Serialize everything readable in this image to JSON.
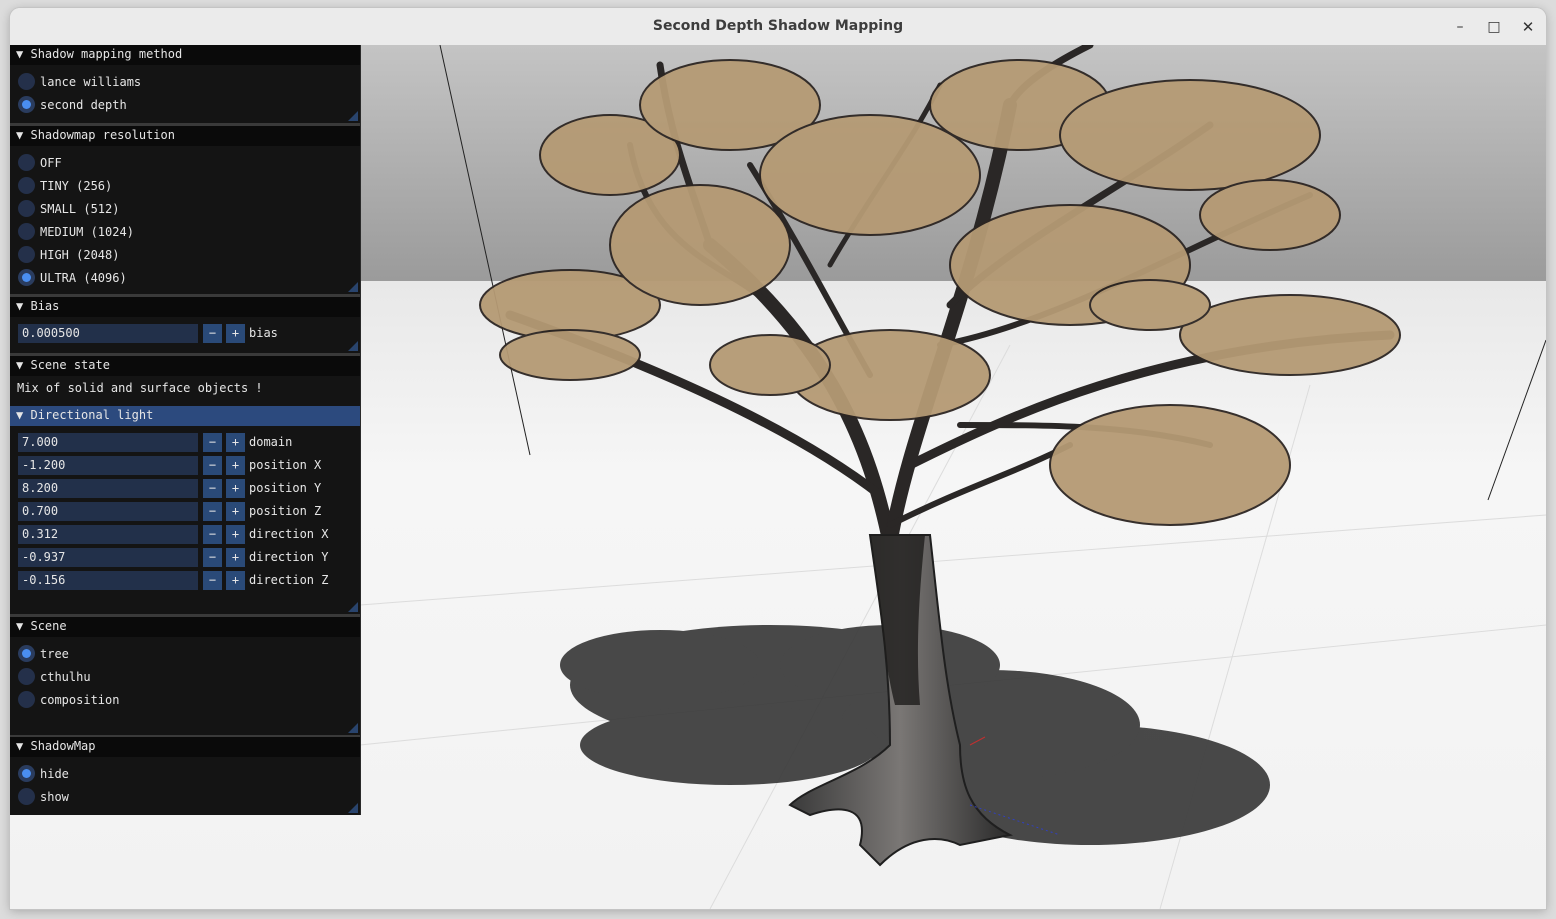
{
  "window": {
    "title": "Second Depth Shadow Mapping",
    "controls": {
      "minimize_glyph": "–",
      "maximize_glyph": "□",
      "close_glyph": "✕"
    }
  },
  "panel": {
    "shadow_method": {
      "title": "Shadow mapping method",
      "options": [
        "lance williams",
        "second depth"
      ],
      "selected": 1
    },
    "resolution": {
      "title": "Shadowmap resolution",
      "options": [
        "OFF",
        "TINY (256)",
        "SMALL (512)",
        "MEDIUM (1024)",
        "HIGH (2048)",
        "ULTRA (4096)"
      ],
      "selected": 5
    },
    "bias": {
      "title": "Bias",
      "value": "0.000500",
      "label": "bias"
    },
    "scene_state": {
      "title": "Scene state",
      "text": "Mix of solid and surface objects !"
    },
    "light": {
      "title": "Directional light",
      "fields": [
        {
          "value": "7.000",
          "label": "domain"
        },
        {
          "value": "-1.200",
          "label": "position X"
        },
        {
          "value": "8.200",
          "label": "position Y"
        },
        {
          "value": "0.700",
          "label": "position Z"
        },
        {
          "value": "0.312",
          "label": "direction X"
        },
        {
          "value": "-0.937",
          "label": "direction Y"
        },
        {
          "value": "-0.156",
          "label": "direction Z"
        }
      ]
    },
    "scene": {
      "title": "Scene",
      "options": [
        "tree",
        "cthulhu",
        "composition"
      ],
      "selected": 0
    },
    "shadowmap": {
      "title": "ShadowMap",
      "options": [
        "hide",
        "show"
      ],
      "selected": 0
    },
    "collapse_glyph": "▼",
    "minus_glyph": "−",
    "plus_glyph": "+"
  },
  "colors": {
    "panel_bg": "#141414",
    "header_bg": "#0a0a0a",
    "active_header": "#2c4a7e",
    "field_bg": "#22304a",
    "radio_on": "#4a8ef0"
  }
}
